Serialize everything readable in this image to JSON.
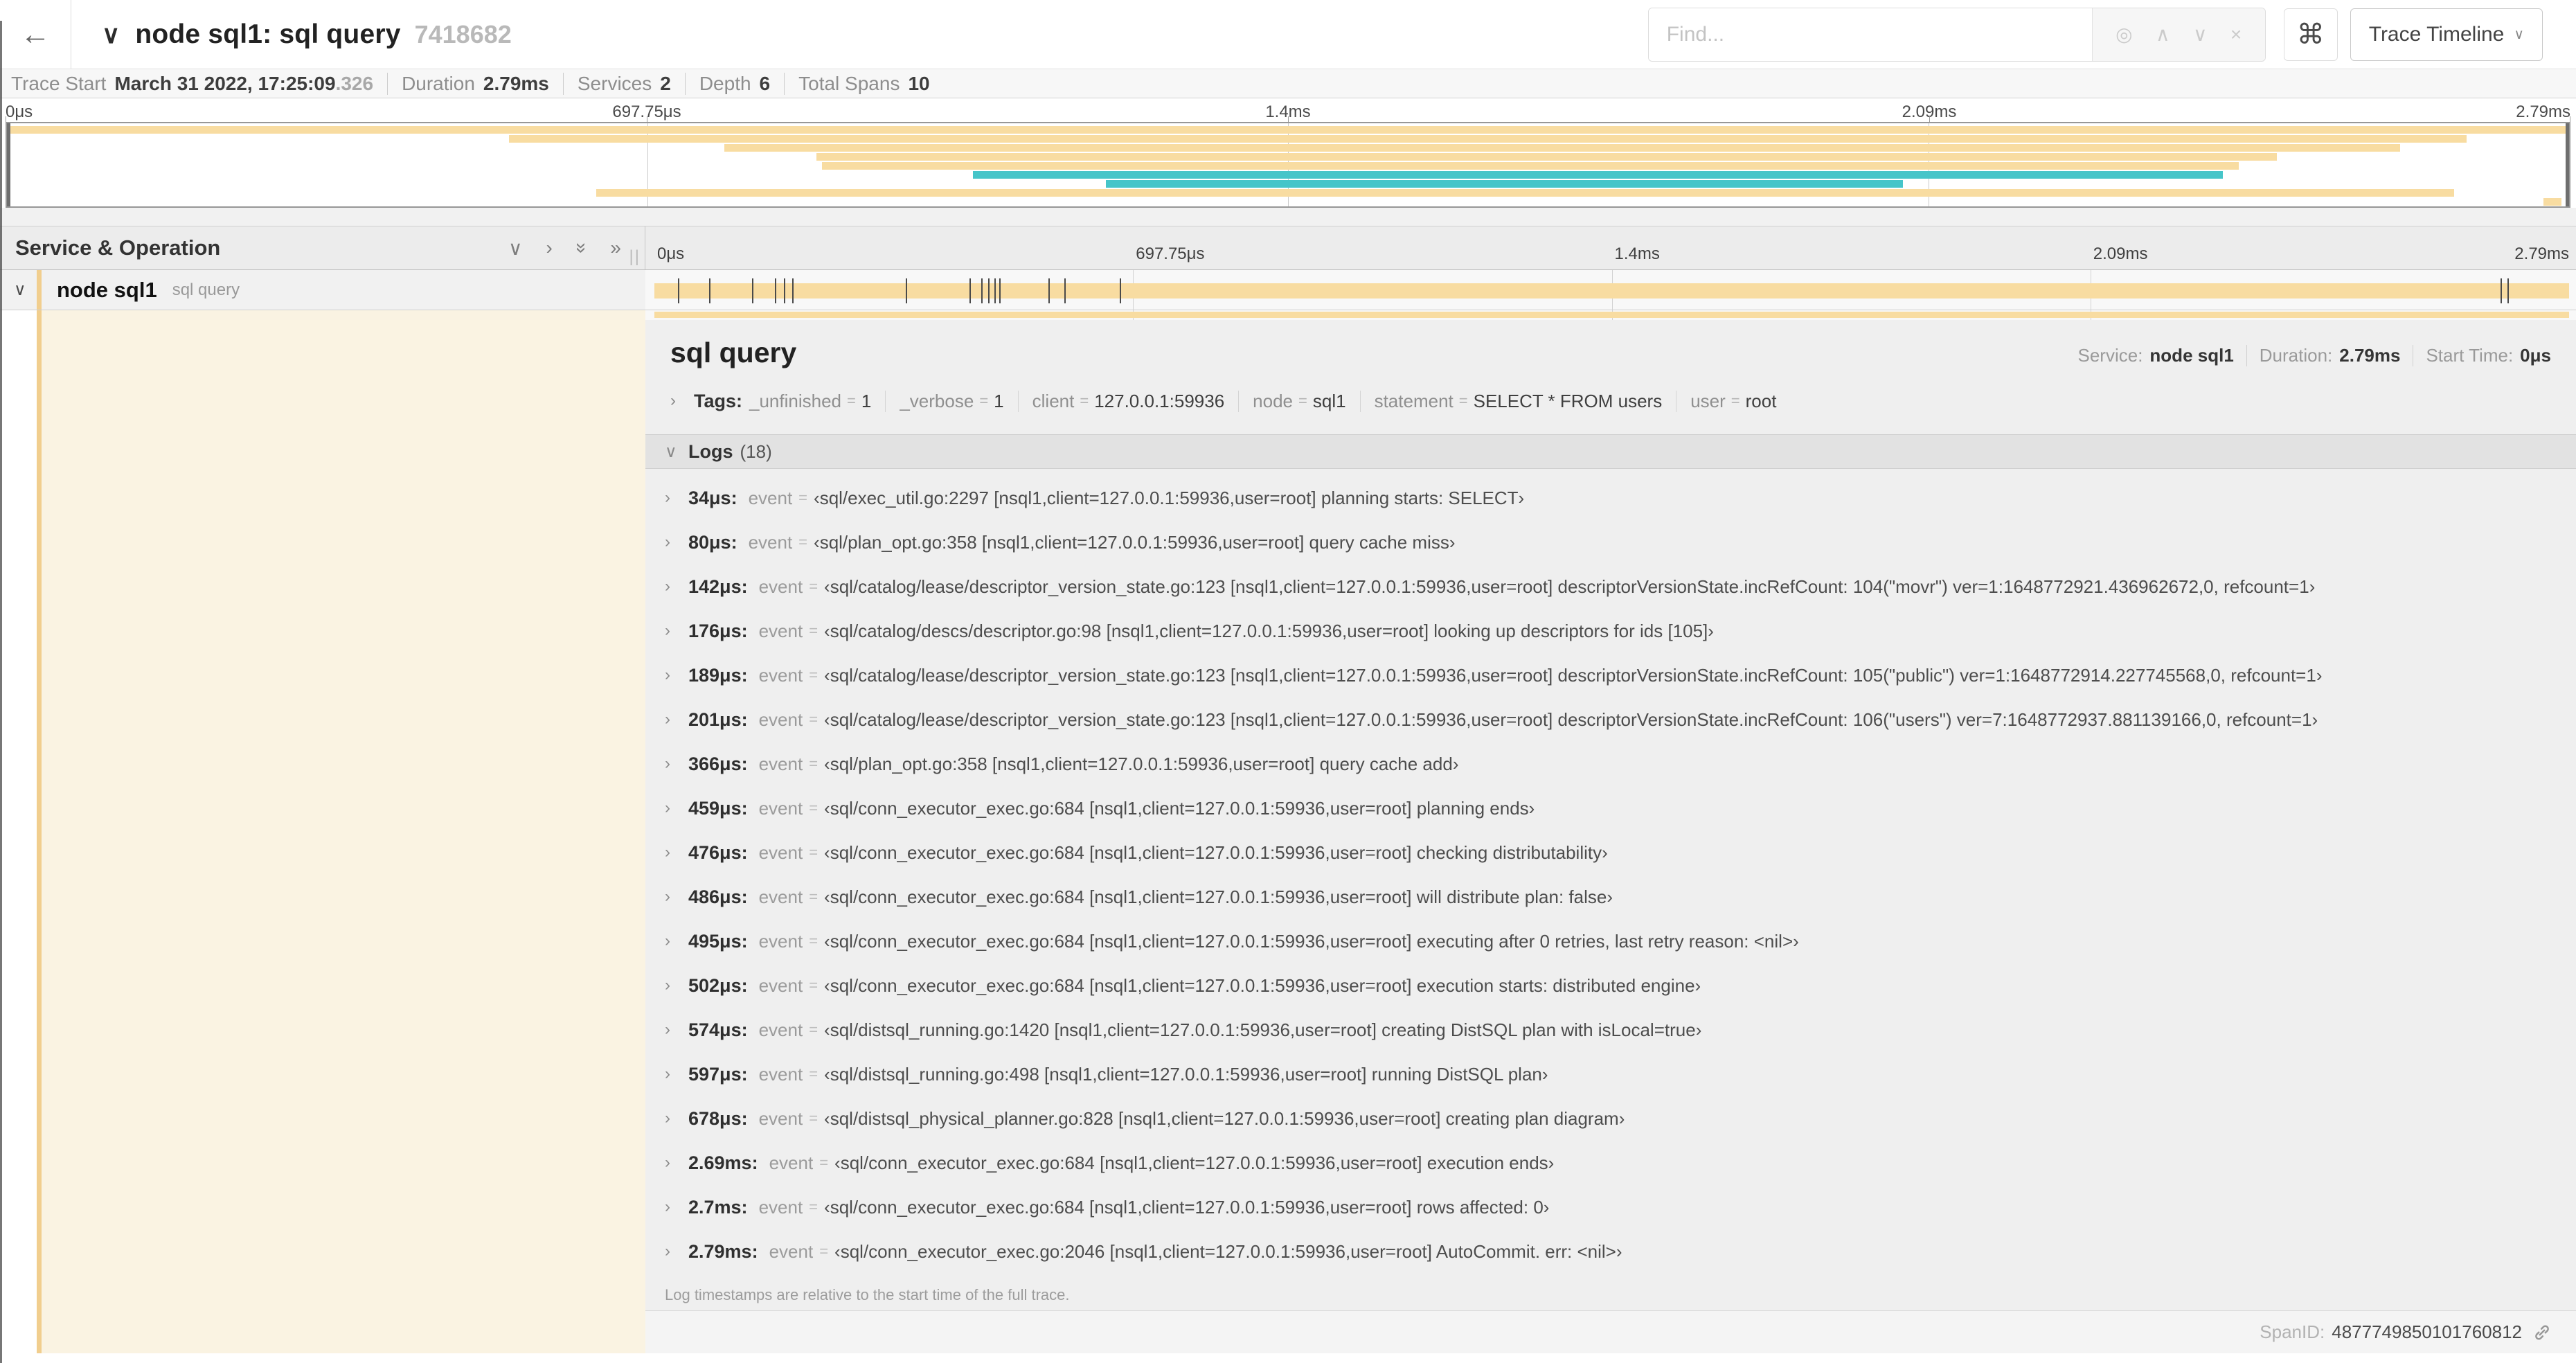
{
  "window": {
    "title": "node sql1: sql query",
    "trace_id": "7418682"
  },
  "header": {
    "back_icon": "←",
    "collapse_icon": "∨",
    "find_placeholder": "Find...",
    "find_icons": {
      "locate": "◎",
      "prev": "∧",
      "next": "∨",
      "clear": "×"
    },
    "shortcut_icon": "⌘",
    "view_selector": "Trace Timeline",
    "view_caret": "∨"
  },
  "summary": {
    "items": [
      {
        "label": "Trace Start",
        "value": "March 31 2022, 17:25:09",
        "suffix": ".326"
      },
      {
        "label": "Duration",
        "value": "2.79ms"
      },
      {
        "label": "Services",
        "value": "2"
      },
      {
        "label": "Depth",
        "value": "6"
      },
      {
        "label": "Total Spans",
        "value": "10"
      }
    ]
  },
  "minimap": {
    "ticks": [
      {
        "label": "0μs",
        "pos": 0
      },
      {
        "label": "697.75μs",
        "pos": 25
      },
      {
        "label": "1.4ms",
        "pos": 50
      },
      {
        "label": "2.09ms",
        "pos": 75
      },
      {
        "label": "2.79ms",
        "pos": 100
      }
    ],
    "spans": [
      {
        "start": 0,
        "end": 100,
        "color": "tan"
      },
      {
        "start": 19.6,
        "end": 96.0,
        "color": "tan"
      },
      {
        "start": 28.0,
        "end": 93.4,
        "color": "tan"
      },
      {
        "start": 31.6,
        "end": 88.6,
        "color": "tan"
      },
      {
        "start": 31.8,
        "end": 87.1,
        "color": "tan"
      },
      {
        "start": 37.7,
        "end": 86.5,
        "color": "teal"
      },
      {
        "start": 42.9,
        "end": 74.0,
        "color": "teal"
      },
      {
        "start": 23.0,
        "end": 95.5,
        "color": "tan"
      },
      {
        "start": 99.0,
        "end": 99.7,
        "color": "tan"
      }
    ]
  },
  "timeline": {
    "column_header": "Service & Operation",
    "header_icons": [
      "∨",
      "›",
      "»",
      "»"
    ],
    "resizer": "||",
    "ticks": [
      {
        "label": "0μs",
        "pos": 0
      },
      {
        "label": "697.75μs",
        "pos": 25
      },
      {
        "label": "1.4ms",
        "pos": 50
      },
      {
        "label": "2.09ms",
        "pos": 75
      },
      {
        "label": "2.79ms",
        "pos": 100
      }
    ],
    "span": {
      "chevron": "∨",
      "service": "node sql1",
      "operation": "sql query"
    },
    "log_markers_pct": [
      1.22,
      2.87,
      5.09,
      6.31,
      6.77,
      7.2,
      13.12,
      16.45,
      17.06,
      17.42,
      17.74,
      18.0,
      20.57,
      21.4,
      24.3,
      96.42,
      96.77
    ]
  },
  "detail": {
    "title": "sql query",
    "meta": [
      {
        "label": "Service:",
        "value": "node sql1"
      },
      {
        "label": "Duration:",
        "value": "2.79ms"
      },
      {
        "label": "Start Time:",
        "value": "0μs"
      }
    ],
    "tags_label": "Tags:",
    "tags": [
      {
        "key": "_unfinished",
        "value": "1"
      },
      {
        "key": "_verbose",
        "value": "1"
      },
      {
        "key": "client",
        "value": "127.0.0.1:59936"
      },
      {
        "key": "node",
        "value": "sql1"
      },
      {
        "key": "statement",
        "value": "SELECT * FROM users"
      },
      {
        "key": "user",
        "value": "root"
      }
    ],
    "logs_label": "Logs",
    "logs_count": "(18)",
    "log_field": "event",
    "logs": [
      {
        "time": "34μs:",
        "value": "‹sql/exec_util.go:2297 [nsql1,client=127.0.0.1:59936,user=root] planning starts: SELECT›"
      },
      {
        "time": "80μs:",
        "value": "‹sql/plan_opt.go:358 [nsql1,client=127.0.0.1:59936,user=root] query cache miss›"
      },
      {
        "time": "142μs:",
        "value": "‹sql/catalog/lease/descriptor_version_state.go:123 [nsql1,client=127.0.0.1:59936,user=root] descriptorVersionState.incRefCount: 104(\"movr\") ver=1:1648772921.436962672,0, refcount=1›"
      },
      {
        "time": "176μs:",
        "value": "‹sql/catalog/descs/descriptor.go:98 [nsql1,client=127.0.0.1:59936,user=root] looking up descriptors for ids [105]›"
      },
      {
        "time": "189μs:",
        "value": "‹sql/catalog/lease/descriptor_version_state.go:123 [nsql1,client=127.0.0.1:59936,user=root] descriptorVersionState.incRefCount: 105(\"public\") ver=1:1648772914.227745568,0, refcount=1›"
      },
      {
        "time": "201μs:",
        "value": "‹sql/catalog/lease/descriptor_version_state.go:123 [nsql1,client=127.0.0.1:59936,user=root] descriptorVersionState.incRefCount: 106(\"users\") ver=7:1648772937.881139166,0, refcount=1›"
      },
      {
        "time": "366μs:",
        "value": "‹sql/plan_opt.go:358 [nsql1,client=127.0.0.1:59936,user=root] query cache add›"
      },
      {
        "time": "459μs:",
        "value": "‹sql/conn_executor_exec.go:684 [nsql1,client=127.0.0.1:59936,user=root] planning ends›"
      },
      {
        "time": "476μs:",
        "value": "‹sql/conn_executor_exec.go:684 [nsql1,client=127.0.0.1:59936,user=root] checking distributability›"
      },
      {
        "time": "486μs:",
        "value": "‹sql/conn_executor_exec.go:684 [nsql1,client=127.0.0.1:59936,user=root] will distribute plan: false›"
      },
      {
        "time": "495μs:",
        "value": "‹sql/conn_executor_exec.go:684 [nsql1,client=127.0.0.1:59936,user=root] executing after 0 retries, last retry reason: <nil>›"
      },
      {
        "time": "502μs:",
        "value": "‹sql/conn_executor_exec.go:684 [nsql1,client=127.0.0.1:59936,user=root] execution starts: distributed engine›"
      },
      {
        "time": "574μs:",
        "value": "‹sql/distsql_running.go:1420 [nsql1,client=127.0.0.1:59936,user=root] creating DistSQL plan with isLocal=true›"
      },
      {
        "time": "597μs:",
        "value": "‹sql/distsql_running.go:498 [nsql1,client=127.0.0.1:59936,user=root] running DistSQL plan›"
      },
      {
        "time": "678μs:",
        "value": "‹sql/distsql_physical_planner.go:828 [nsql1,client=127.0.0.1:59936,user=root] creating plan diagram›"
      },
      {
        "time": "2.69ms:",
        "value": "‹sql/conn_executor_exec.go:684 [nsql1,client=127.0.0.1:59936,user=root] execution ends›"
      },
      {
        "time": "2.7ms:",
        "value": "‹sql/conn_executor_exec.go:684 [nsql1,client=127.0.0.1:59936,user=root] rows affected: 0›"
      },
      {
        "time": "2.79ms:",
        "value": "‹sql/conn_executor_exec.go:2046 [nsql1,client=127.0.0.1:59936,user=root] AutoCommit. err: <nil>›"
      }
    ],
    "footer": "Log timestamps are relative to the start time of the full trace.",
    "span_id_label": "SpanID:",
    "span_id": "4877749850101760812"
  },
  "colors": {
    "tan": "#F8DCA1",
    "teal": "#46C5C9",
    "cream": "#FAF3E2",
    "strip": "#F1CE8E"
  }
}
